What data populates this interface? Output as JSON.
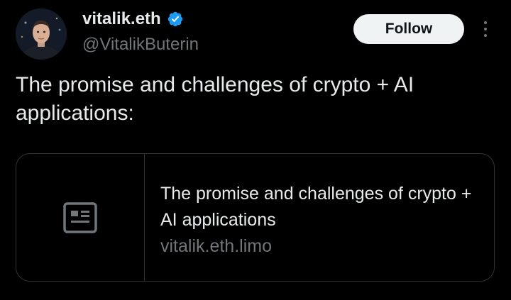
{
  "author": {
    "display_name": "vitalik.eth",
    "handle": "@VitalikButerin",
    "verified": true,
    "avatar_icon": "profile-photo"
  },
  "actions": {
    "follow_label": "Follow",
    "more_icon": "more-options-icon"
  },
  "tweet": {
    "text": "The promise and challenges of crypto + AI applications:"
  },
  "link_card": {
    "thumbnail_icon": "article-icon",
    "title": "The promise and challenges of crypto + AI applications",
    "domain": "vitalik.eth.limo"
  },
  "colors": {
    "background": "#000000",
    "primary_text": "#e7e9ea",
    "secondary_text": "#71767b",
    "verified_badge": "#1d9bf0",
    "border": "#2f3336",
    "follow_bg": "#eff3f4"
  }
}
